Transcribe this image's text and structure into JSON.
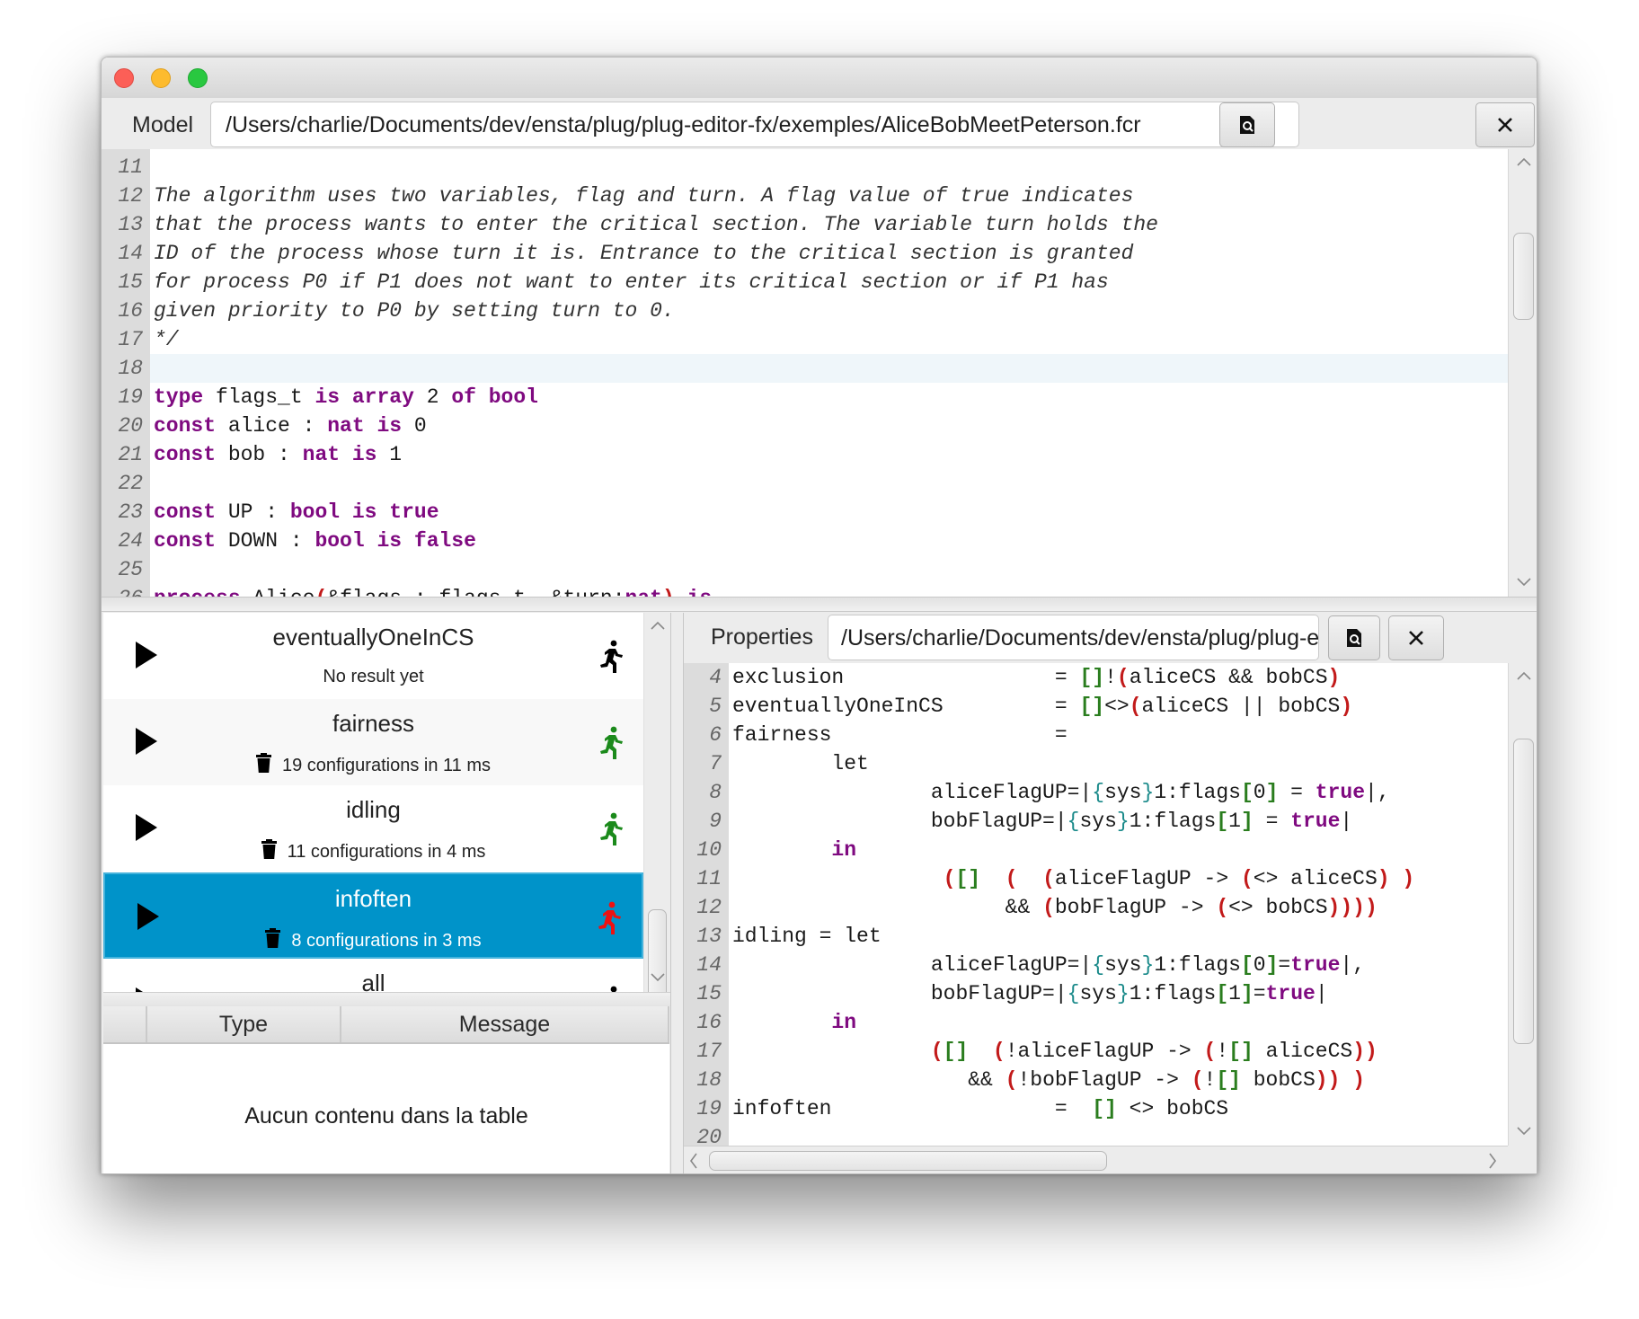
{
  "window": {
    "traffic_lights": [
      "close",
      "minimize",
      "zoom"
    ]
  },
  "model_bar": {
    "label": "Model",
    "path": "/Users/charlie/Documents/dev/ensta/plug/plug-editor-fx/exemples/AliceBobMeetPeterson.fcr",
    "open_icon": "file-search-icon",
    "close_icon": "close-icon"
  },
  "model_editor": {
    "lines": [
      {
        "n": "11",
        "segs": [
          {
            "t": "",
            "c": "comment"
          }
        ]
      },
      {
        "n": "12",
        "segs": [
          {
            "t": "The algorithm uses two variables, flag and turn. A flag value of true indicates",
            "c": "comment"
          }
        ]
      },
      {
        "n": "13",
        "segs": [
          {
            "t": "that the process wants to enter the critical section. The variable turn holds the",
            "c": "comment"
          }
        ]
      },
      {
        "n": "14",
        "segs": [
          {
            "t": "ID of the process whose turn it is. Entrance to the critical section is granted",
            "c": "comment"
          }
        ]
      },
      {
        "n": "15",
        "segs": [
          {
            "t": "for process P0 if P1 does not want to enter its critical section or if P1 has",
            "c": "comment"
          }
        ]
      },
      {
        "n": "16",
        "segs": [
          {
            "t": "given priority to P0 by setting turn to 0.",
            "c": "comment"
          }
        ]
      },
      {
        "n": "17",
        "segs": [
          {
            "t": "*/",
            "c": "comment"
          }
        ]
      },
      {
        "n": "18",
        "segs": [],
        "highlight": true
      },
      {
        "n": "19",
        "segs": [
          {
            "t": "type",
            "c": "kw"
          },
          {
            "t": " flags_t "
          },
          {
            "t": "is",
            "c": "kw"
          },
          {
            "t": " "
          },
          {
            "t": "array",
            "c": "kw"
          },
          {
            "t": " 2 "
          },
          {
            "t": "of",
            "c": "kw"
          },
          {
            "t": " "
          },
          {
            "t": "bool",
            "c": "kw"
          }
        ]
      },
      {
        "n": "20",
        "segs": [
          {
            "t": "const",
            "c": "kw"
          },
          {
            "t": " alice : "
          },
          {
            "t": "nat",
            "c": "kw"
          },
          {
            "t": " "
          },
          {
            "t": "is",
            "c": "kw"
          },
          {
            "t": " 0"
          }
        ]
      },
      {
        "n": "21",
        "segs": [
          {
            "t": "const",
            "c": "kw"
          },
          {
            "t": " bob : "
          },
          {
            "t": "nat",
            "c": "kw"
          },
          {
            "t": " "
          },
          {
            "t": "is",
            "c": "kw"
          },
          {
            "t": " 1"
          }
        ]
      },
      {
        "n": "22",
        "segs": []
      },
      {
        "n": "23",
        "segs": [
          {
            "t": "const",
            "c": "kw"
          },
          {
            "t": " UP : "
          },
          {
            "t": "bool",
            "c": "kw"
          },
          {
            "t": " "
          },
          {
            "t": "is",
            "c": "kw"
          },
          {
            "t": " "
          },
          {
            "t": "true",
            "c": "kw"
          }
        ]
      },
      {
        "n": "24",
        "segs": [
          {
            "t": "const",
            "c": "kw"
          },
          {
            "t": " DOWN : "
          },
          {
            "t": "bool",
            "c": "kw"
          },
          {
            "t": " "
          },
          {
            "t": "is",
            "c": "kw"
          },
          {
            "t": " "
          },
          {
            "t": "false",
            "c": "kw"
          }
        ]
      },
      {
        "n": "25",
        "segs": []
      },
      {
        "n": "26",
        "segs": [
          {
            "t": "process",
            "c": "kw"
          },
          {
            "t": " Alice"
          },
          {
            "t": "(",
            "c": "pa"
          },
          {
            "t": "&flags : flags_t, &turn:"
          },
          {
            "t": "nat",
            "c": "kw"
          },
          {
            "t": ")",
            "c": "pa"
          },
          {
            "t": " "
          },
          {
            "t": "is",
            "c": "kw"
          }
        ]
      }
    ]
  },
  "properties_list": {
    "items": [
      {
        "name": "eventuallyOneInCS",
        "result": "No result yet",
        "has_trash": false,
        "status": "not-run",
        "status_color": "#000000",
        "selected": false
      },
      {
        "name": "fairness",
        "result": "19 configurations in 11 ms",
        "has_trash": true,
        "status": "satisfied",
        "status_color": "#1b8a1b",
        "selected": false
      },
      {
        "name": "idling",
        "result": "11 configurations in 4 ms",
        "has_trash": true,
        "status": "satisfied",
        "status_color": "#1b8a1b",
        "selected": false
      },
      {
        "name": "infoften",
        "result": "8 configurations in 3 ms",
        "has_trash": true,
        "status": "violated",
        "status_color": "#ee1111",
        "selected": true
      },
      {
        "name": "all",
        "result": "",
        "has_trash": false,
        "status": "not-run",
        "status_color": "#000000",
        "selected": false
      }
    ],
    "play_icon": "play-icon",
    "trash_icon": "trash-icon",
    "status_icon": "running-man-icon",
    "selection_color": "#0093c9"
  },
  "messages_table": {
    "columns": [
      "",
      "Type",
      "Message"
    ],
    "empty_text": "Aucun contenu dans la table"
  },
  "properties_bar": {
    "label": "Properties",
    "path": "/Users/charlie/Documents/dev/ensta/plug/plug-e",
    "open_icon": "file-search-icon",
    "close_icon": "close-icon"
  },
  "properties_editor": {
    "lines": [
      {
        "n": "4",
        "segs": [
          {
            "t": "exclusion                 = "
          },
          {
            "t": "[]",
            "c": "br"
          },
          {
            "t": "!"
          },
          {
            "t": "(",
            "c": "pa"
          },
          {
            "t": "aliceCS && bobCS"
          },
          {
            "t": ")",
            "c": "pa"
          }
        ]
      },
      {
        "n": "5",
        "segs": [
          {
            "t": "eventuallyOneInCS         = "
          },
          {
            "t": "[]",
            "c": "br"
          },
          {
            "t": "<>"
          },
          {
            "t": "(",
            "c": "pa"
          },
          {
            "t": "aliceCS || bobCS"
          },
          {
            "t": ")",
            "c": "pa"
          }
        ]
      },
      {
        "n": "6",
        "segs": [
          {
            "t": "fairness                  ="
          }
        ]
      },
      {
        "n": "7",
        "segs": [
          {
            "t": "        let"
          }
        ]
      },
      {
        "n": "8",
        "segs": [
          {
            "t": "                aliceFlagUP=|"
          },
          {
            "t": "{",
            "c": "cu"
          },
          {
            "t": "sys"
          },
          {
            "t": "}",
            "c": "cu"
          },
          {
            "t": "1:flags"
          },
          {
            "t": "[",
            "c": "br"
          },
          {
            "t": "0"
          },
          {
            "t": "]",
            "c": "br"
          },
          {
            "t": " = "
          },
          {
            "t": "true",
            "c": "kw"
          },
          {
            "t": "|,"
          }
        ]
      },
      {
        "n": "9",
        "segs": [
          {
            "t": "                bobFlagUP=|"
          },
          {
            "t": "{",
            "c": "cu"
          },
          {
            "t": "sys"
          },
          {
            "t": "}",
            "c": "cu"
          },
          {
            "t": "1:flags"
          },
          {
            "t": "[",
            "c": "br"
          },
          {
            "t": "1"
          },
          {
            "t": "]",
            "c": "br"
          },
          {
            "t": " = "
          },
          {
            "t": "true",
            "c": "kw"
          },
          {
            "t": "|"
          }
        ]
      },
      {
        "n": "10",
        "segs": [
          {
            "t": "        "
          },
          {
            "t": "in",
            "c": "kw"
          }
        ]
      },
      {
        "n": "11",
        "segs": [
          {
            "t": "                 "
          },
          {
            "t": "(",
            "c": "pa"
          },
          {
            "t": "[]",
            "c": "br"
          },
          {
            "t": "  "
          },
          {
            "t": "(",
            "c": "pa"
          },
          {
            "t": "  "
          },
          {
            "t": "(",
            "c": "pa"
          },
          {
            "t": "aliceFlagUP -> "
          },
          {
            "t": "(",
            "c": "pa"
          },
          {
            "t": "<> aliceCS"
          },
          {
            "t": ")",
            "c": "pa"
          },
          {
            "t": " "
          },
          {
            "t": ")",
            "c": "pa"
          }
        ]
      },
      {
        "n": "12",
        "segs": [
          {
            "t": "                      && "
          },
          {
            "t": "(",
            "c": "pa"
          },
          {
            "t": "bobFlagUP -> "
          },
          {
            "t": "(",
            "c": "pa"
          },
          {
            "t": "<> bobCS"
          },
          {
            "t": "))))",
            "c": "pa"
          }
        ]
      },
      {
        "n": "13",
        "segs": [
          {
            "t": "idling = let"
          }
        ]
      },
      {
        "n": "14",
        "segs": [
          {
            "t": "                aliceFlagUP=|"
          },
          {
            "t": "{",
            "c": "cu"
          },
          {
            "t": "sys"
          },
          {
            "t": "}",
            "c": "cu"
          },
          {
            "t": "1:flags"
          },
          {
            "t": "[",
            "c": "br"
          },
          {
            "t": "0"
          },
          {
            "t": "]",
            "c": "br"
          },
          {
            "t": "="
          },
          {
            "t": "true",
            "c": "kw"
          },
          {
            "t": "|,"
          }
        ]
      },
      {
        "n": "15",
        "segs": [
          {
            "t": "                bobFlagUP=|"
          },
          {
            "t": "{",
            "c": "cu"
          },
          {
            "t": "sys"
          },
          {
            "t": "}",
            "c": "cu"
          },
          {
            "t": "1:flags"
          },
          {
            "t": "[",
            "c": "br"
          },
          {
            "t": "1"
          },
          {
            "t": "]",
            "c": "br"
          },
          {
            "t": "="
          },
          {
            "t": "true",
            "c": "kw"
          },
          {
            "t": "|"
          }
        ]
      },
      {
        "n": "16",
        "segs": [
          {
            "t": "        "
          },
          {
            "t": "in",
            "c": "kw"
          }
        ]
      },
      {
        "n": "17",
        "segs": [
          {
            "t": "                "
          },
          {
            "t": "(",
            "c": "pa"
          },
          {
            "t": "[]",
            "c": "br"
          },
          {
            "t": "  "
          },
          {
            "t": "(",
            "c": "pa"
          },
          {
            "t": "!aliceFlagUP -> "
          },
          {
            "t": "(",
            "c": "pa"
          },
          {
            "t": "!"
          },
          {
            "t": "[]",
            "c": "br"
          },
          {
            "t": " aliceCS"
          },
          {
            "t": "))",
            "c": "pa"
          }
        ]
      },
      {
        "n": "18",
        "segs": [
          {
            "t": "                   && "
          },
          {
            "t": "(",
            "c": "pa"
          },
          {
            "t": "!bobFlagUP -> "
          },
          {
            "t": "(",
            "c": "pa"
          },
          {
            "t": "!"
          },
          {
            "t": "[]",
            "c": "br"
          },
          {
            "t": " bobCS"
          },
          {
            "t": "))",
            "c": "pa"
          },
          {
            "t": " "
          },
          {
            "t": ")",
            "c": "pa"
          }
        ]
      },
      {
        "n": "19",
        "segs": [
          {
            "t": "infoften                  =  "
          },
          {
            "t": "[]",
            "c": "br"
          },
          {
            "t": " <> bobCS"
          }
        ]
      },
      {
        "n": "20",
        "segs": []
      }
    ]
  }
}
